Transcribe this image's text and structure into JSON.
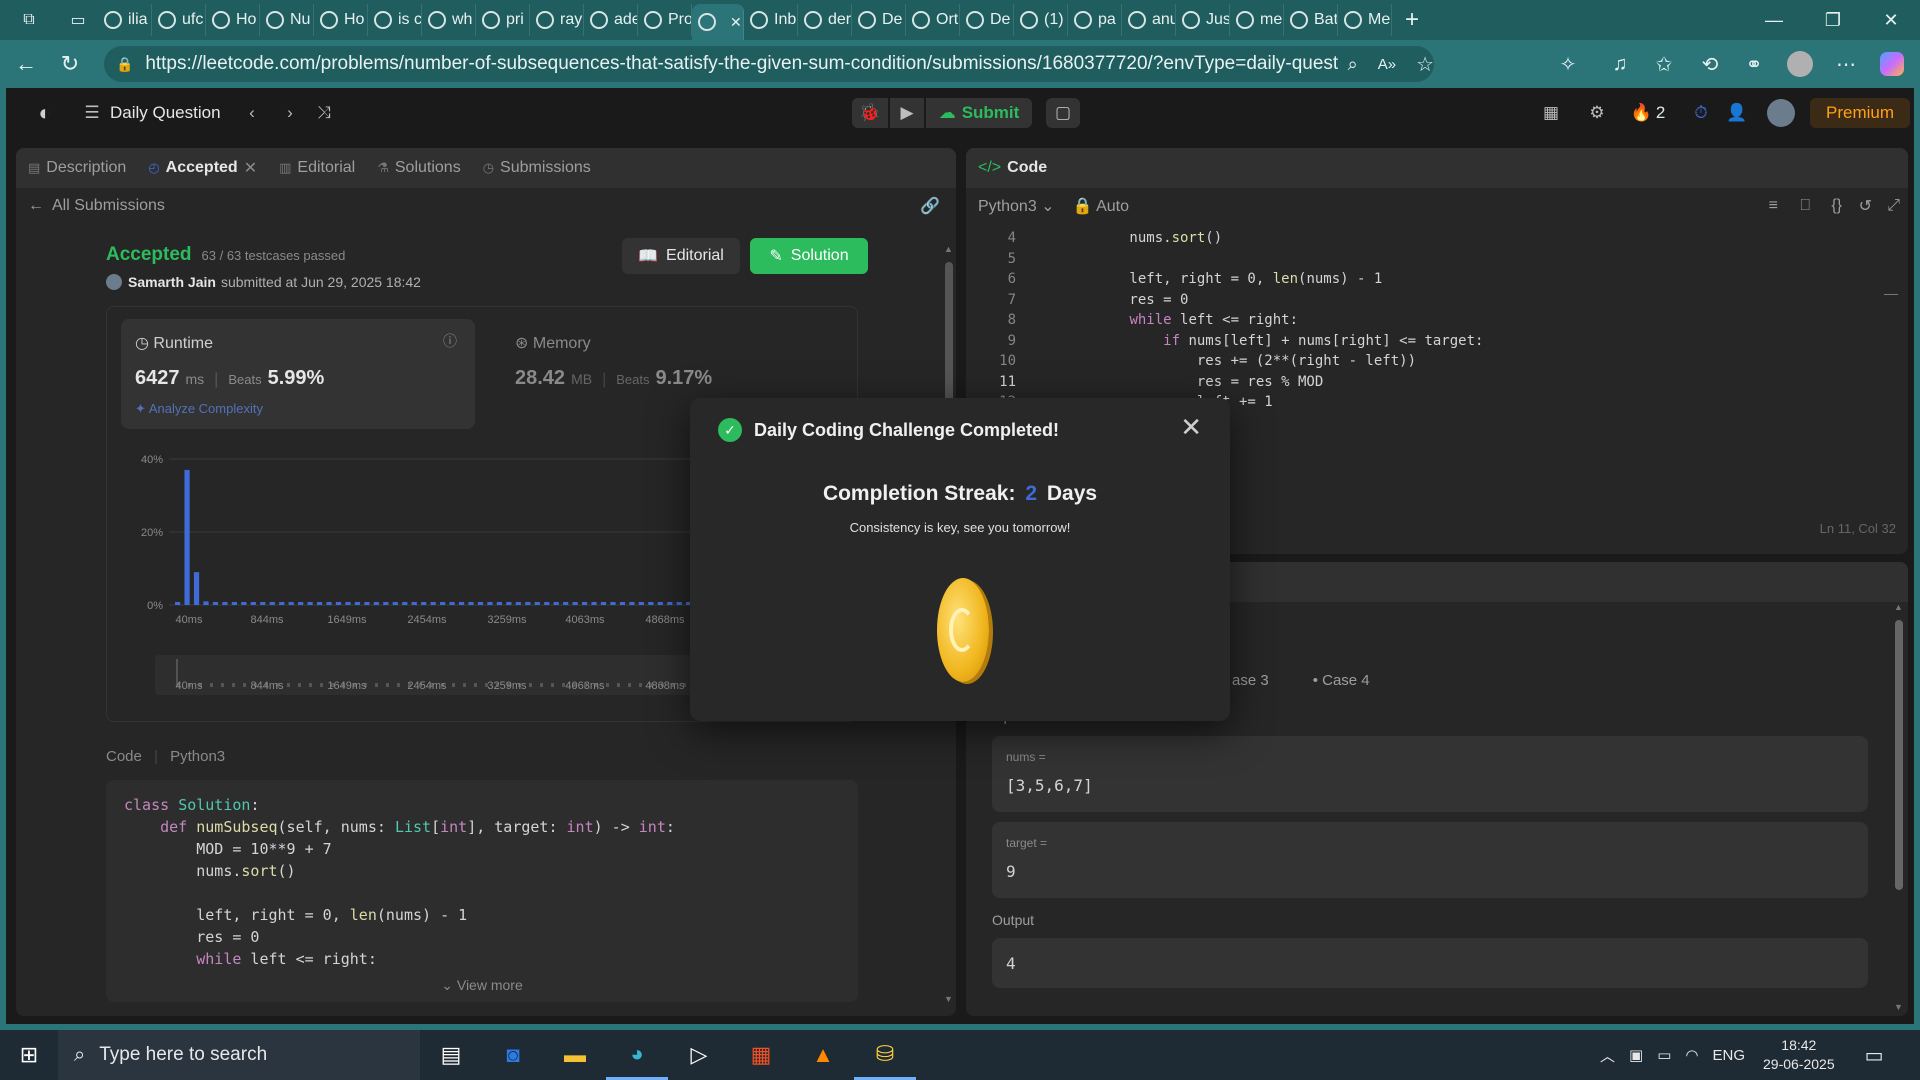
{
  "browser": {
    "tabs": [
      "ilia",
      "ufc",
      "Ho",
      "Nu",
      "Ho",
      "is c",
      "wh",
      "pri",
      "ray",
      "ade",
      "Pro",
      "",
      "Inb",
      "der",
      "De",
      "Ort",
      "De",
      "(1)",
      "pa",
      "anu",
      "Jus",
      "me",
      "Bat",
      "Me"
    ],
    "url": "https://leetcode.com/problems/number-of-subsequences-that-satisfy-the-given-sum-condition/submissions/1680377720/?envType=daily-question&envId=2025-...",
    "new_tab": "+"
  },
  "lc": {
    "nav_title": "Daily Question",
    "submit_label": "Submit",
    "streak_count": "2",
    "premium_label": "Premium",
    "left_tabs": [
      "Description",
      "Accepted",
      "Editorial",
      "Solutions",
      "Submissions"
    ],
    "all_submissions": "All Submissions",
    "status": "Accepted",
    "testcases": "63 / 63 testcases passed",
    "user": "Samarth Jain",
    "submitted_text": "submitted at Jun 29, 2025 18:42",
    "editorial_btn": "Editorial",
    "solution_btn": "Solution",
    "runtime": {
      "label": "Runtime",
      "value": "6427",
      "unit": "ms",
      "beats_label": "Beats",
      "beats": "5.99%",
      "analyze": "Analyze Complexity"
    },
    "memory": {
      "label": "Memory",
      "value": "28.42",
      "unit": "MB",
      "beats_label": "Beats",
      "beats": "9.17%"
    },
    "code_label": "Code",
    "code_lang": "Python3",
    "view_more": "View more",
    "right_title": "Code",
    "editor_lang": "Python3",
    "editor_mode": "Auto",
    "cursor_pos": "Ln 11, Col 32",
    "cases": [
      "ase 3",
      "Case 4"
    ],
    "input_label": "Input",
    "var1_name": "nums =",
    "var1_value": "[3,5,6,7]",
    "var2_name": "target =",
    "var2_value": "9",
    "output_label": "Output",
    "output_value": "4"
  },
  "chart_data": {
    "type": "bar",
    "x_ticks": [
      "40ms",
      "844ms",
      "1649ms",
      "2454ms",
      "3259ms",
      "4063ms",
      "4868ms"
    ],
    "y_ticks": [
      "40%",
      "20%",
      "0%"
    ],
    "ylim": [
      0,
      40
    ],
    "values": [
      0.8,
      37,
      9,
      1,
      0.6,
      0.5,
      0.5,
      0.4,
      0.4,
      0.4,
      0.4,
      0.4,
      0.4,
      0.4,
      0.4,
      0.4,
      0.4,
      0.4,
      0.4,
      0.4,
      0.4,
      0.4,
      0.4,
      0.4,
      0.4,
      0.4,
      0.4,
      0.4,
      0.4,
      0.4,
      0.4,
      0.4,
      0.4,
      0.4,
      0.4,
      0.4,
      0.4,
      0.4,
      0.4,
      0.4,
      0.4,
      0.4,
      0.4,
      0.4,
      0.4,
      0.4,
      0.4,
      0.4,
      0.4,
      0.4,
      0.4,
      0.4,
      0.4,
      0.4,
      0.4,
      0.4,
      0.4,
      0.4,
      0.4,
      0.4,
      0.4,
      0.4,
      0.4,
      0.4,
      0.4,
      0.4,
      0.4,
      0.4,
      0.4,
      0.4,
      0.4
    ],
    "color": "#3f6bd8"
  },
  "modal": {
    "title": "Daily Coding Challenge Completed!",
    "streak_prefix": "Completion Streak:",
    "streak_value": "2",
    "streak_suffix": "Days",
    "message": "Consistency is key, see you tomorrow!"
  },
  "taskbar": {
    "search_placeholder": "Type here to search",
    "lang": "ENG",
    "time": "18:42",
    "date": "29-06-2025"
  },
  "colors": {
    "accent_green": "#2cbb5d",
    "accent_blue": "#3f6bd8",
    "lc_orange": "#ffa116",
    "browser_teal": "#2b7579"
  }
}
